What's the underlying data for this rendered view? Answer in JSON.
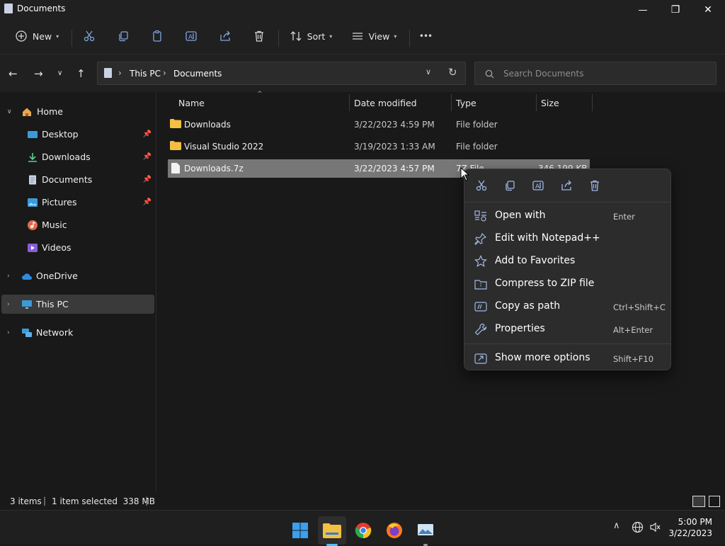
{
  "window": {
    "title": "Documents"
  },
  "window_controls": {
    "minimize": "—",
    "maximize": "❐",
    "close": "✕"
  },
  "toolbar": {
    "new_label": "New",
    "sort_label": "Sort",
    "view_label": "View",
    "more_label": "•••"
  },
  "address": {
    "crumb1": "This PC",
    "crumb2": "Documents",
    "sep": "›"
  },
  "search": {
    "placeholder": "Search Documents"
  },
  "sidebar": {
    "items": [
      {
        "label": "Home"
      },
      {
        "label": "Desktop"
      },
      {
        "label": "Downloads"
      },
      {
        "label": "Documents"
      },
      {
        "label": "Pictures"
      },
      {
        "label": "Music"
      },
      {
        "label": "Videos"
      },
      {
        "label": "OneDrive"
      },
      {
        "label": "This PC"
      },
      {
        "label": "Network"
      }
    ]
  },
  "columns": {
    "name": "Name",
    "date": "Date modified",
    "type": "Type",
    "size": "Size"
  },
  "files": [
    {
      "name": "Downloads",
      "date": "3/22/2023 4:59 PM",
      "type": "File folder",
      "size": ""
    },
    {
      "name": "Visual Studio 2022",
      "date": "3/19/2023 1:33 AM",
      "type": "File folder",
      "size": ""
    },
    {
      "name": "Downloads.7z",
      "date": "3/22/2023 4:57 PM",
      "type": "7Z File",
      "size": "346,199 KB"
    }
  ],
  "context_menu": {
    "items": [
      {
        "label": "Open with",
        "shortcut": "Enter"
      },
      {
        "label": "Edit with Notepad++",
        "shortcut": ""
      },
      {
        "label": "Add to Favorites",
        "shortcut": ""
      },
      {
        "label": "Compress to ZIP file",
        "shortcut": ""
      },
      {
        "label": "Copy as path",
        "shortcut": "Ctrl+Shift+C"
      },
      {
        "label": "Properties",
        "shortcut": "Alt+Enter"
      },
      {
        "label": "Show more options",
        "shortcut": "Shift+F10"
      }
    ]
  },
  "status": {
    "items": "3 items",
    "selected": "1 item selected  338 MB"
  },
  "taskbar": {
    "time": "5:00 PM",
    "date": "3/22/2023"
  },
  "colors": {
    "accent": "#4cc2ff",
    "folder": "#f4c042",
    "selection": "#777777"
  }
}
